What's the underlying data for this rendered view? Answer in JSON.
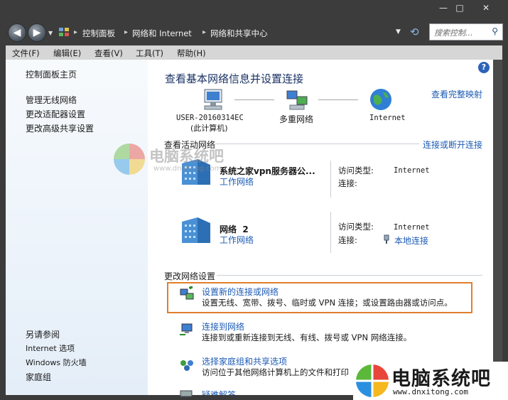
{
  "window": {
    "min_glyph": "—",
    "max_glyph": "□",
    "close_glyph": "✕"
  },
  "address": {
    "crumbs": [
      "控制面板",
      "网络和 Internet",
      "网络和共享中心"
    ],
    "separator": "▸",
    "search_placeholder": "搜索控制...",
    "search_icon": "⚲"
  },
  "menu": {
    "items": [
      "文件(F)",
      "编辑(E)",
      "查看(V)",
      "工具(T)",
      "帮助(H)"
    ]
  },
  "left_pane": {
    "home": "控制面板主页",
    "tasks": [
      "管理无线网络",
      "更改适配器设置",
      "更改高级共享设置"
    ],
    "see_also_title": "另请参阅",
    "see_also": [
      "Internet 选项",
      "Windows 防火墙",
      "家庭组"
    ]
  },
  "main": {
    "help_glyph": "?",
    "title": "查看基本网络信息并设置连接",
    "full_map_link": "查看完整映射",
    "map": {
      "computer_name": "USER-20160314EC",
      "computer_sub": "(此计算机)",
      "middle": "多重网络",
      "internet": "Internet"
    },
    "active_title": "查看活动网络",
    "connect_link": "连接或断开连接",
    "networks": [
      {
        "name": "系统之家vpn服务器公...",
        "type": "工作网络",
        "access_label": "访问类型:",
        "access_value": "Internet",
        "conn_label": "连接:",
        "conn_value": ""
      },
      {
        "name": "网络  2",
        "type": "工作网络",
        "access_label": "访问类型:",
        "access_value": "Internet",
        "conn_label": "连接:",
        "conn_value": "本地连接"
      }
    ],
    "change_title": "更改网络设置",
    "tasks": [
      {
        "title": "设置新的连接或网络",
        "desc": "设置无线、宽带、拨号、临时或 VPN 连接；或设置路由器或访问点。"
      },
      {
        "title": "连接到网络",
        "desc": "连接到或重新连接到无线、有线、拨号或 VPN 网络连接。"
      },
      {
        "title": "选择家庭组和共享选项",
        "desc": "访问位于其他网络计算机上的文件和打印"
      },
      {
        "title": "疑难解答",
        "desc": ""
      }
    ]
  },
  "watermark": {
    "top_text": "电脑系统吧",
    "top_url": "www.dnxitong.com",
    "bottom_text": "电脑系统吧",
    "bottom_url": "www.dnxitong.com"
  },
  "colors": {
    "link": "#1c5bb5",
    "highlight": "#e07f2d",
    "chrome": "#3c3c3c"
  }
}
